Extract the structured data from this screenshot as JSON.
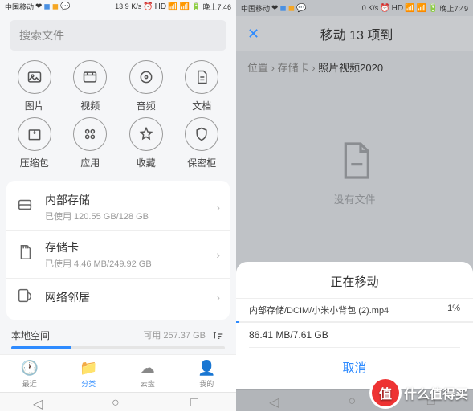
{
  "phone1": {
    "status": {
      "carrier": "中国移动",
      "speed": "13.9 K/s",
      "time": "晚上7:46"
    },
    "search_placeholder": "搜索文件",
    "categories": [
      {
        "label": "图片",
        "icon": "image-icon"
      },
      {
        "label": "视频",
        "icon": "video-icon"
      },
      {
        "label": "音频",
        "icon": "audio-icon"
      },
      {
        "label": "文档",
        "icon": "document-icon"
      },
      {
        "label": "压缩包",
        "icon": "archive-icon"
      },
      {
        "label": "应用",
        "icon": "app-icon"
      },
      {
        "label": "收藏",
        "icon": "favorite-icon"
      },
      {
        "label": "保密柜",
        "icon": "safe-icon"
      }
    ],
    "storage": [
      {
        "title": "内部存储",
        "sub": "已使用 120.55 GB/128 GB"
      },
      {
        "title": "存储卡",
        "sub": "已使用 4.46 MB/249.92 GB"
      },
      {
        "title": "网络邻居",
        "sub": ""
      }
    ],
    "local_label": "本地空间",
    "avail_label": "可用 257.37 GB",
    "tabs": [
      {
        "label": "最近"
      },
      {
        "label": "分类"
      },
      {
        "label": "云盘"
      },
      {
        "label": "我的"
      }
    ]
  },
  "phone2": {
    "status": {
      "carrier": "中国移动",
      "speed": "0 K/s",
      "time": "晚上7:49"
    },
    "title": "移动 13 项到",
    "breadcrumb": {
      "p0": "位置",
      "p1": "存储卡",
      "p2": "照片视频2020"
    },
    "empty_label": "没有文件",
    "sheet": {
      "title": "正在移动",
      "path": "内部存储/DCIM/小米小背包 (2).mp4",
      "percent": "1%",
      "size": "86.41 MB/7.61 GB",
      "cancel": "取消"
    }
  },
  "watermark": {
    "badge": "值",
    "text": "什么值得买"
  }
}
